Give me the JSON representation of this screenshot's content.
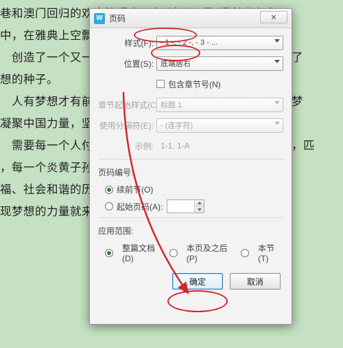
{
  "bg_text": "巷和澳门回归的欢声笑语中，在“神州五号”顺利升上太\n中，在雅典上空飘扬的五星红旗中，您迎来了一次又一次\n　创造了一个又一个奇迹，在您几千年的智慧灵中，播撒了\n想的种子。\n　人有梦想才有前行的动力，实现梦想的力量。实现中国梦\n凝聚中国力量，坚定走中国道路，这是一项光荣而艰巨\n　需要每一个人付出辛勤的劳动和不懈的努力。天下兴亡，匹\n，每一个炎黄子孙都要肩负起国家富强、民族复兴、\n福、社会和谐的历史重任，为实现中华民族共同梦想而\n现梦想的力量就来自于我们每一个人的努力。",
  "dlg": {
    "title": "页码",
    "style_lbl": "样式(F):",
    "style_val": "- 1 -, - 2 -, - 3 - ...",
    "pos_lbl": "位置(S):",
    "pos_val": "底端居右",
    "chapter_chk": "包含章节号(N)",
    "chap_style_lbl": "章节起始样式(C):",
    "chap_style_val": "标题 1",
    "sep_lbl": "使用分隔符(E):",
    "sep_val": "- (连字符)",
    "example_lbl": "示例:",
    "example_val": "1-1, 1-A",
    "numbering_hdr": "页码编号:",
    "continue_lbl": "续前节(O)",
    "startat_lbl": "起始页码(A):",
    "scope_hdr": "应用范围:",
    "whole_lbl": "整篇文档(D)",
    "after_lbl": "本页及之后(P)",
    "section_lbl": "本节(T)",
    "ok": "确定",
    "cancel": "取消"
  }
}
